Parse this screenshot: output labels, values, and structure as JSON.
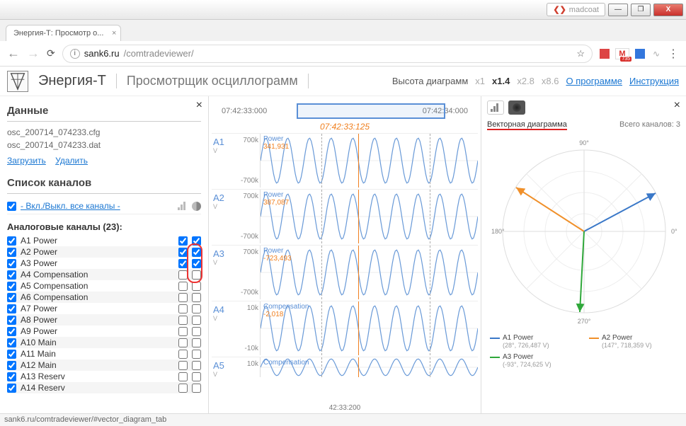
{
  "window": {
    "user_label": "madcoat",
    "min_symbol": "—",
    "max_symbol": "❐",
    "close_symbol": "X"
  },
  "browser": {
    "tab_title": "Энергия-Т: Просмотр о...",
    "url_host": "sank6.ru",
    "url_path": "/comtradeviewer/",
    "gmail_count": "735",
    "star": "☆",
    "menu_dots": "⋮"
  },
  "app": {
    "title": "Энергия-Т",
    "subtitle": "Просмотрщик осциллограмм",
    "scale_label": "Высота диаграмм",
    "scales": {
      "x1": "x1",
      "x14": "x1.4",
      "x28": "x2.8",
      "x86": "x8.6"
    },
    "link_about": "О программе",
    "link_manual": "Инструкция"
  },
  "left": {
    "data_title": "Данные",
    "file_cfg": "osc_200714_074233.cfg",
    "file_dat": "osc_200714_074233.dat",
    "load": "Загрузить",
    "delete": "Удалить",
    "channels_title": "Список каналов",
    "toggle_all": "- Вкл./Выкл. все каналы -",
    "analog_title": "Аналоговые каналы (23):",
    "channels": [
      {
        "name": "A1 Power",
        "c1": true,
        "c2": true,
        "c3": true,
        "circled": true
      },
      {
        "name": "A2 Power",
        "c1": true,
        "c2": true,
        "c3": true,
        "circled": true
      },
      {
        "name": "A3 Power",
        "c1": true,
        "c2": true,
        "c3": true,
        "circled": true
      },
      {
        "name": "A4 Compensation",
        "c1": true,
        "c2": false,
        "c3": false,
        "circled": false
      },
      {
        "name": "A5 Compensation",
        "c1": true,
        "c2": false,
        "c3": false,
        "circled": false
      },
      {
        "name": "A6 Compensation",
        "c1": true,
        "c2": false,
        "c3": false,
        "circled": false
      },
      {
        "name": "A7 Power",
        "c1": true,
        "c2": false,
        "c3": false,
        "circled": false
      },
      {
        "name": "A8 Power",
        "c1": true,
        "c2": false,
        "c3": false,
        "circled": false
      },
      {
        "name": "A9 Power",
        "c1": true,
        "c2": false,
        "c3": false,
        "circled": false
      },
      {
        "name": "A10 Main",
        "c1": true,
        "c2": false,
        "c3": false,
        "circled": false
      },
      {
        "name": "A11 Main",
        "c1": true,
        "c2": false,
        "c3": false,
        "circled": false
      },
      {
        "name": "A12 Main",
        "c1": true,
        "c2": false,
        "c3": false,
        "circled": false
      },
      {
        "name": "A13 Reserv",
        "c1": true,
        "c2": false,
        "c3": false,
        "circled": false
      },
      {
        "name": "A14 Reserv",
        "c1": true,
        "c2": false,
        "c3": false,
        "circled": false
      }
    ]
  },
  "center": {
    "t_start": "07:42:33:000",
    "t_end": "07:42:34:000",
    "cursor_time": "07:42:33:125",
    "bottom_time": "42:33:200",
    "waves": [
      {
        "id": "A1",
        "unit": "V",
        "top": "700k",
        "bot": "-700k",
        "name": "Power",
        "val": "341,931"
      },
      {
        "id": "A2",
        "unit": "V",
        "top": "700k",
        "bot": "-700k",
        "name": "Power",
        "val": "387,087"
      },
      {
        "id": "A3",
        "unit": "V",
        "top": "700k",
        "bot": "-700k",
        "name": "Power",
        "val": "-723,493"
      },
      {
        "id": "A4",
        "unit": "V",
        "top": "10k",
        "bot": "-10k",
        "name": "Compensation",
        "val": "-2,018"
      },
      {
        "id": "A5",
        "unit": "V",
        "top": "10k",
        "bot": "",
        "name": "Compensation",
        "val": ""
      }
    ]
  },
  "right": {
    "vec_title": "Векторная диаграмма",
    "vec_count": "Всего каналов: 3",
    "deg_0": "0°",
    "deg_90": "90°",
    "deg_180": "180°",
    "deg_270": "270°",
    "legend": [
      {
        "name": "A1 Power",
        "val": "(28°, 726,487 V)",
        "color": "#3a78c8"
      },
      {
        "name": "A2 Power",
        "val": "(147°, 718,359 V)",
        "color": "#f0902a"
      },
      {
        "name": "A3 Power",
        "val": "(-93°, 724,625 V)",
        "color": "#2fa83a"
      }
    ]
  },
  "status": "sank6.ru/comtradeviewer/#vector_diagram_tab",
  "chart_data": {
    "vector_diagram": {
      "type": "polar-vectors",
      "vectors": [
        {
          "name": "A1 Power",
          "angle_deg": 28,
          "magnitude_v": 726487,
          "color": "#3a78c8"
        },
        {
          "name": "A2 Power",
          "angle_deg": 147,
          "magnitude_v": 718359,
          "color": "#f0902a"
        },
        {
          "name": "A3 Power",
          "angle_deg": -93,
          "magnitude_v": 724625,
          "color": "#2fa83a"
        }
      ]
    },
    "waveforms": [
      {
        "id": "A1",
        "name": "Power",
        "unit": "V",
        "ylim": [
          -700000,
          700000
        ],
        "cursor_value": 341931
      },
      {
        "id": "A2",
        "name": "Power",
        "unit": "V",
        "ylim": [
          -700000,
          700000
        ],
        "cursor_value": 387087
      },
      {
        "id": "A3",
        "name": "Power",
        "unit": "V",
        "ylim": [
          -700000,
          700000
        ],
        "cursor_value": -723493
      },
      {
        "id": "A4",
        "name": "Compensation",
        "unit": "V",
        "ylim": [
          -10000,
          10000
        ],
        "cursor_value": -2018
      },
      {
        "id": "A5",
        "name": "Compensation",
        "unit": "V",
        "ylim": [
          -10000,
          10000
        ],
        "cursor_value": null
      }
    ],
    "time_window": {
      "start": "07:42:33:000",
      "end": "07:42:34:000",
      "cursor": "07:42:33:125"
    }
  }
}
